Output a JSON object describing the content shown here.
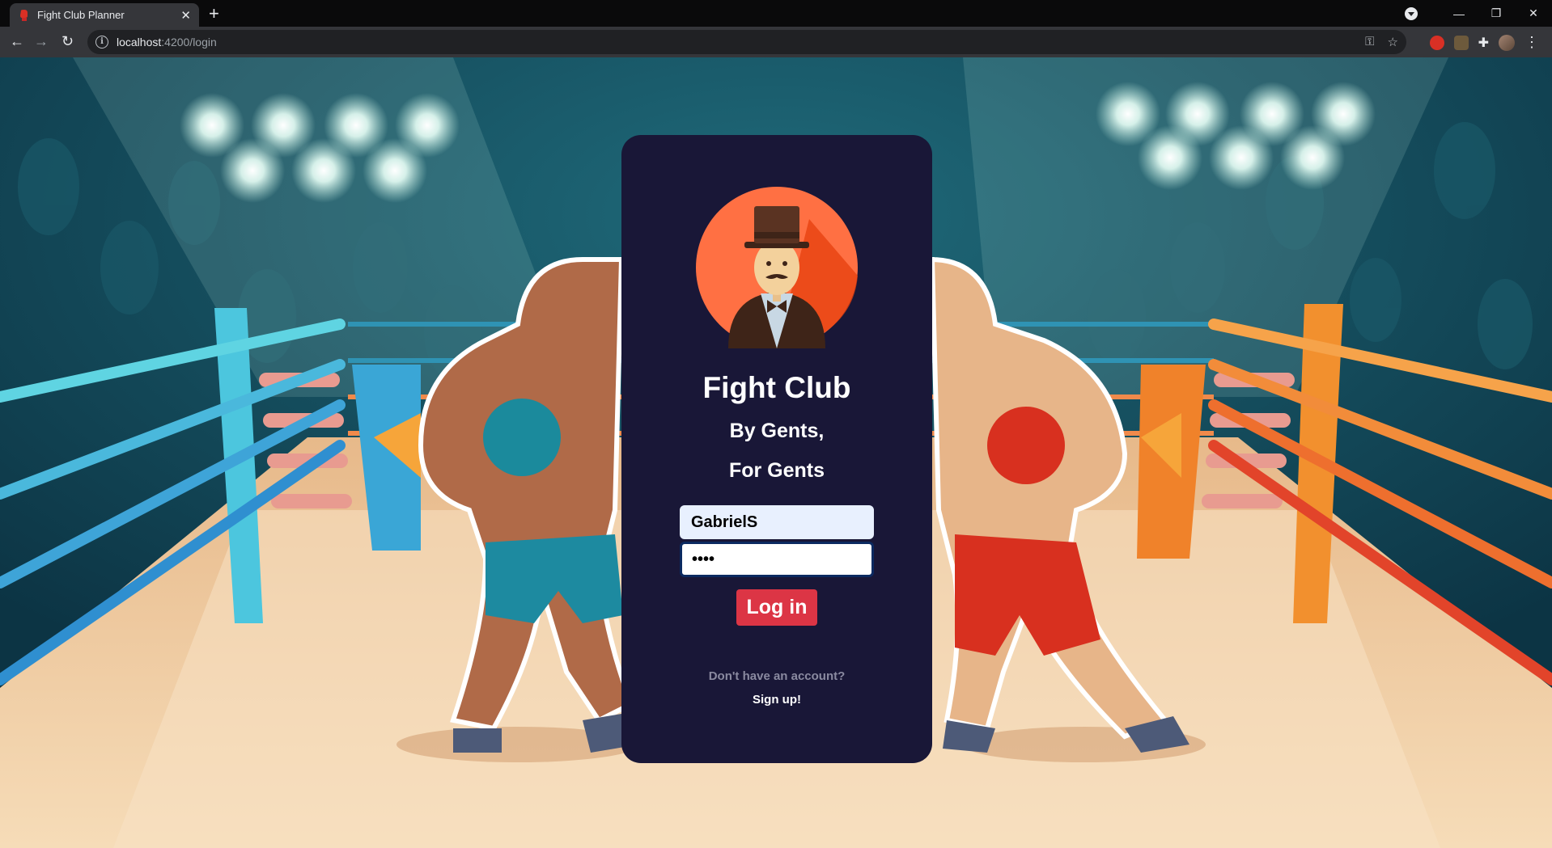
{
  "browser": {
    "tab_title": "Fight Club Planner",
    "url_host": "localhost",
    "url_path": ":4200/login"
  },
  "login": {
    "title": "Fight Club",
    "subtitle_line1": "By Gents,",
    "subtitle_line2": "For Gents",
    "username_value": "GabrielS",
    "password_value": "••••",
    "login_label": "Log in",
    "no_account_text": "Don't have an account?",
    "signup_label": "Sign up!"
  },
  "colors": {
    "card_bg": "#191737",
    "login_button": "#dc3545",
    "arena_bg": "#103a4a"
  }
}
